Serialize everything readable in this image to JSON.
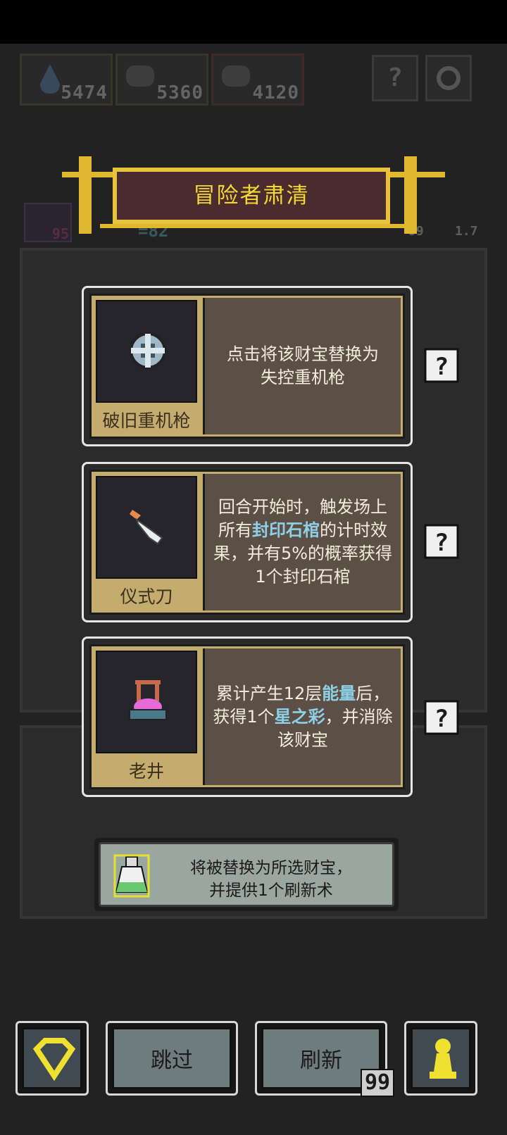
{
  "resources": [
    {
      "icon": "water-drop-icon",
      "value": "5474"
    },
    {
      "icon": "helmet-icon",
      "value": "5360"
    },
    {
      "icon": "helmet-icon",
      "value": "4120"
    }
  ],
  "top_buttons": {
    "help": "?",
    "settings": "gear-icon"
  },
  "banner": {
    "title": "冒险者肃清"
  },
  "background_stats": {
    "left_badge": "95",
    "center": "=82",
    "right_a": "99",
    "right_b": "1.7"
  },
  "cards": [
    {
      "name": "破旧重机枪",
      "icon": "heavy-machine-gun-icon",
      "desc_lines": [
        "点击将该财宝替换为",
        "失控重机枪"
      ],
      "help": "?"
    },
    {
      "name": "仪式刀",
      "icon": "ritual-knife-icon",
      "desc_parts": [
        "回合开始时，触发场上所有",
        "封印石棺",
        "的计时效果，并有5%的概率获得1个封印石棺"
      ],
      "help": "?"
    },
    {
      "name": "老井",
      "icon": "old-well-icon",
      "desc_parts": [
        "累计产生12层",
        "能量",
        "后，获得1个",
        "星之彩",
        "，并消除该财宝"
      ],
      "help": "?"
    }
  ],
  "tip": {
    "lines": [
      "将被替换为所选财宝，",
      "并提供1个刷新术"
    ],
    "icon": "potion-bottle-icon"
  },
  "bottom_bar": {
    "gem_icon": "diamond-icon",
    "skip_label": "跳过",
    "refresh_label": "刷新",
    "refresh_count": "99",
    "pawn_icon": "pawn-icon"
  },
  "colors": {
    "gold": "#e8c23a",
    "card_tan": "#c4ac6e",
    "desc_bg": "#5c5046",
    "highlight": "#8ed0e8"
  }
}
